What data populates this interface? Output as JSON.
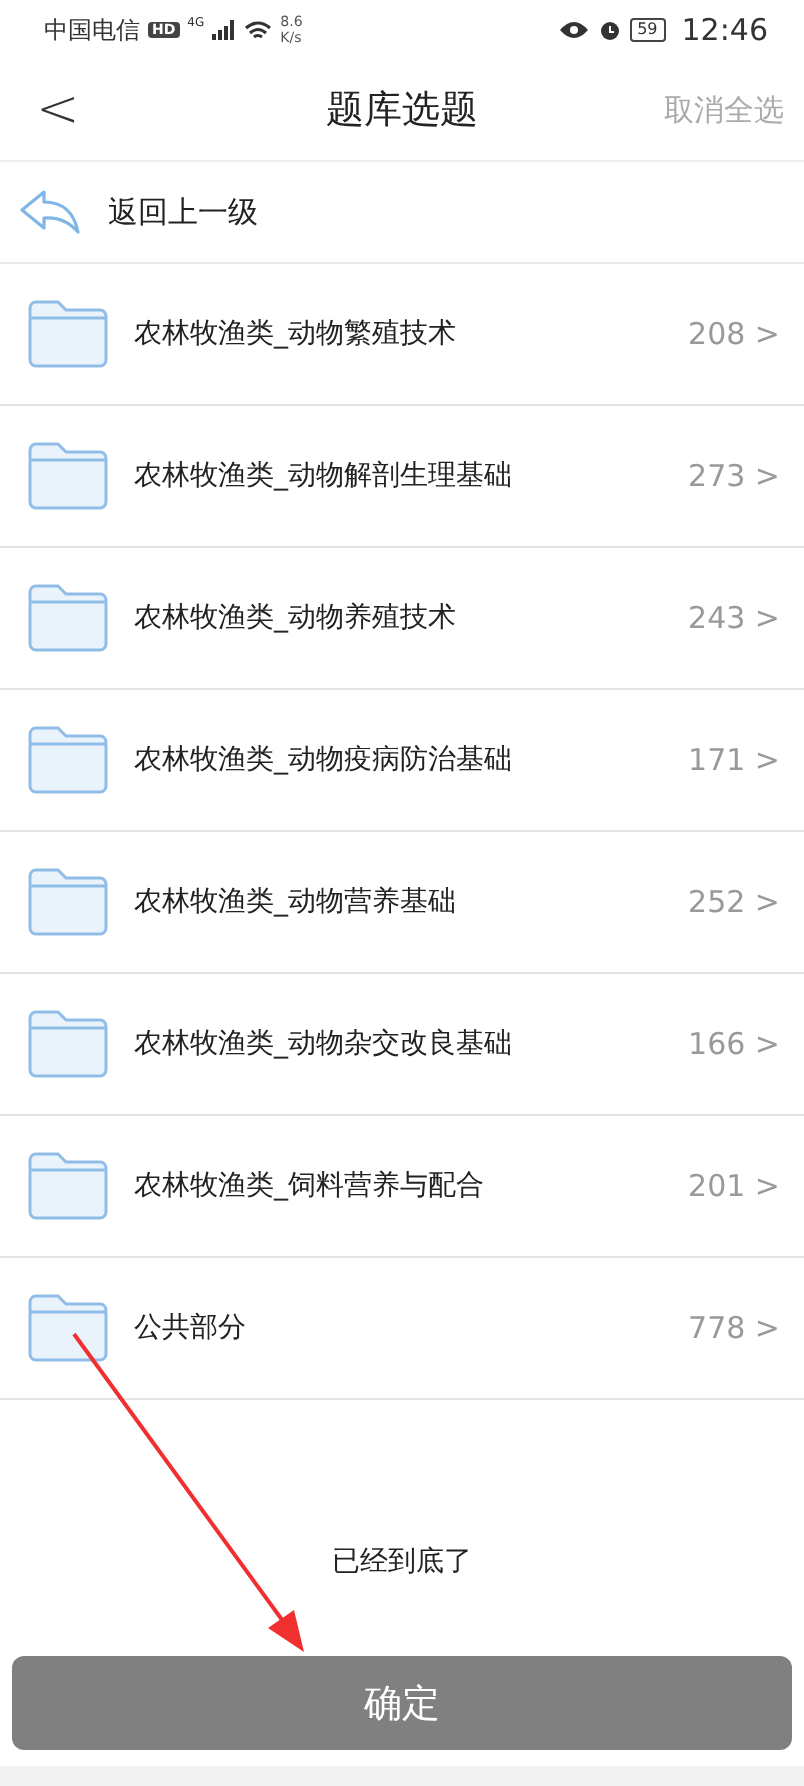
{
  "status_bar": {
    "carrier": "中国电信",
    "hd": "HD",
    "network": "4G",
    "speed": "8.6",
    "speed_unit": "K/s",
    "battery": "59",
    "time": "12:46"
  },
  "header": {
    "back": "<",
    "title": "题库选题",
    "action": "取消全选"
  },
  "back_row": {
    "label": "返回上一级"
  },
  "folders": [
    {
      "name": "农林牧渔类_动物繁殖技术",
      "count": "208 >"
    },
    {
      "name": "农林牧渔类_动物解剖生理基础",
      "count": "273 >"
    },
    {
      "name": "农林牧渔类_动物养殖技术",
      "count": "243 >"
    },
    {
      "name": "农林牧渔类_动物疫病防治基础",
      "count": "171 >"
    },
    {
      "name": "农林牧渔类_动物营养基础",
      "count": "252 >"
    },
    {
      "name": "农林牧渔类_动物杂交改良基础",
      "count": "166 >"
    },
    {
      "name": "农林牧渔类_饲料营养与配合",
      "count": "201 >"
    },
    {
      "name": "公共部分",
      "count": "778 >"
    }
  ],
  "end_note": "已经到底了",
  "confirm": {
    "label": "确定",
    "disabled": true
  }
}
